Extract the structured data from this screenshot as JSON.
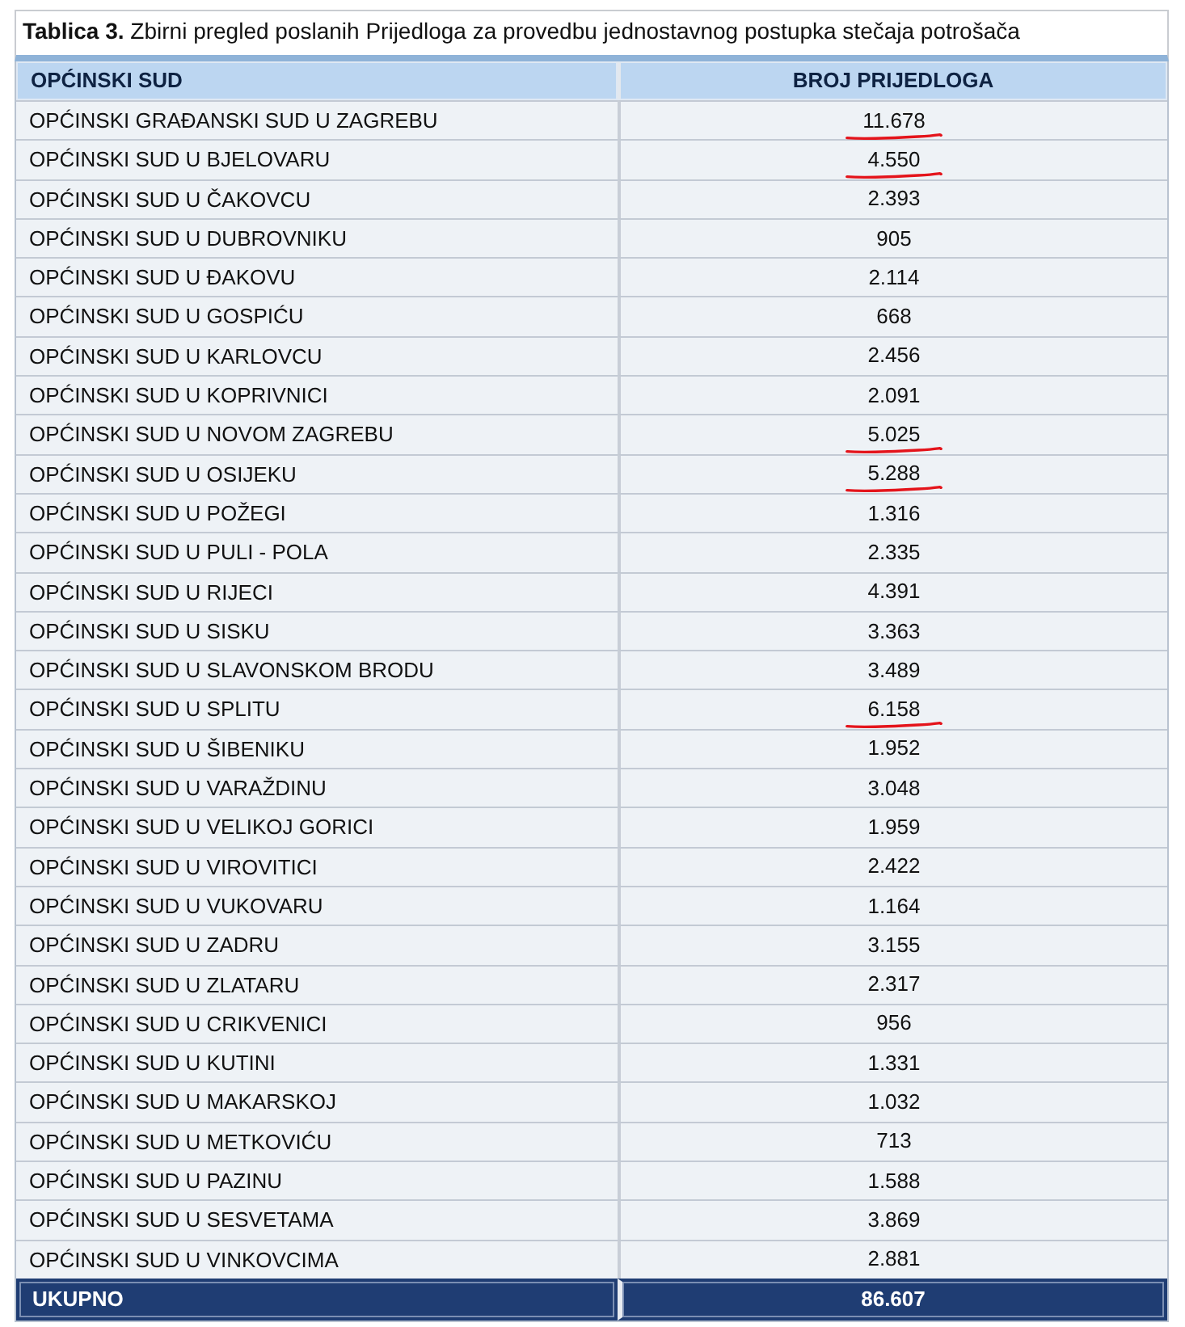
{
  "caption": {
    "label": "Tablica 3.",
    "text": "Zbirni pregled poslanih Prijedloga za provedbu jednostavnog postupka stečaja potrošača"
  },
  "table": {
    "columns": [
      "OPĆINSKI SUD",
      "BROJ PRIJEDLOGA"
    ],
    "rows": [
      {
        "court": "OPĆINSKI GRAĐANSKI SUD U ZAGREBU",
        "count": "11.678",
        "underlined": true
      },
      {
        "court": "OPĆINSKI SUD U BJELOVARU",
        "count": "4.550",
        "underlined": true
      },
      {
        "court": "OPĆINSKI SUD U ČAKOVCU",
        "count": "2.393",
        "underlined": false
      },
      {
        "court": "OPĆINSKI SUD U DUBROVNIKU",
        "count": "905",
        "underlined": false
      },
      {
        "court": "OPĆINSKI SUD U ĐAKOVU",
        "count": "2.114",
        "underlined": false
      },
      {
        "court": "OPĆINSKI SUD U GOSPIĆU",
        "count": "668",
        "underlined": false
      },
      {
        "court": "OPĆINSKI SUD U KARLOVCU",
        "count": "2.456",
        "underlined": false
      },
      {
        "court": "OPĆINSKI SUD U KOPRIVNICI",
        "count": "2.091",
        "underlined": false
      },
      {
        "court": "OPĆINSKI SUD U NOVOM ZAGREBU",
        "count": "5.025",
        "underlined": true
      },
      {
        "court": "OPĆINSKI SUD U OSIJEKU",
        "count": "5.288",
        "underlined": true
      },
      {
        "court": "OPĆINSKI SUD U POŽEGI",
        "count": "1.316",
        "underlined": false
      },
      {
        "court": "OPĆINSKI SUD U PULI - POLA",
        "count": "2.335",
        "underlined": false
      },
      {
        "court": "OPĆINSKI SUD U RIJECI",
        "count": "4.391",
        "underlined": false
      },
      {
        "court": "OPĆINSKI SUD U SISKU",
        "count": "3.363",
        "underlined": false
      },
      {
        "court": "OPĆINSKI SUD U SLAVONSKOM BRODU",
        "count": "3.489",
        "underlined": false
      },
      {
        "court": "OPĆINSKI SUD U SPLITU",
        "count": "6.158",
        "underlined": true
      },
      {
        "court": "OPĆINSKI SUD U ŠIBENIKU",
        "count": "1.952",
        "underlined": false
      },
      {
        "court": "OPĆINSKI SUD U VARAŽDINU",
        "count": "3.048",
        "underlined": false
      },
      {
        "court": "OPĆINSKI SUD U VELIKOJ GORICI",
        "count": "1.959",
        "underlined": false
      },
      {
        "court": "OPĆINSKI SUD U VIROVITICI",
        "count": "2.422",
        "underlined": false
      },
      {
        "court": "OPĆINSKI SUD U VUKOVARU",
        "count": "1.164",
        "underlined": false
      },
      {
        "court": "OPĆINSKI SUD U ZADRU",
        "count": "3.155",
        "underlined": false
      },
      {
        "court": "OPĆINSKI SUD U ZLATARU",
        "count": "2.317",
        "underlined": false
      },
      {
        "court": "OPĆINSKI SUD U CRIKVENICI",
        "count": "956",
        "underlined": false
      },
      {
        "court": "OPĆINSKI SUD U KUTINI",
        "count": "1.331",
        "underlined": false
      },
      {
        "court": "OPĆINSKI SUD U MAKARSKOJ",
        "count": "1.032",
        "underlined": false
      },
      {
        "court": "OPĆINSKI SUD U METKOVIĆU",
        "count": "713",
        "underlined": false
      },
      {
        "court": "OPĆINSKI SUD U PAZINU",
        "count": "1.588",
        "underlined": false
      },
      {
        "court": "OPĆINSKI SUD U SESVETAMA",
        "count": "3.869",
        "underlined": false
      },
      {
        "court": "OPĆINSKI SUD U VINKOVCIMA",
        "count": "2.881",
        "underlined": false
      }
    ],
    "total": {
      "label": "UKUPNO",
      "count": "86.607"
    }
  }
}
